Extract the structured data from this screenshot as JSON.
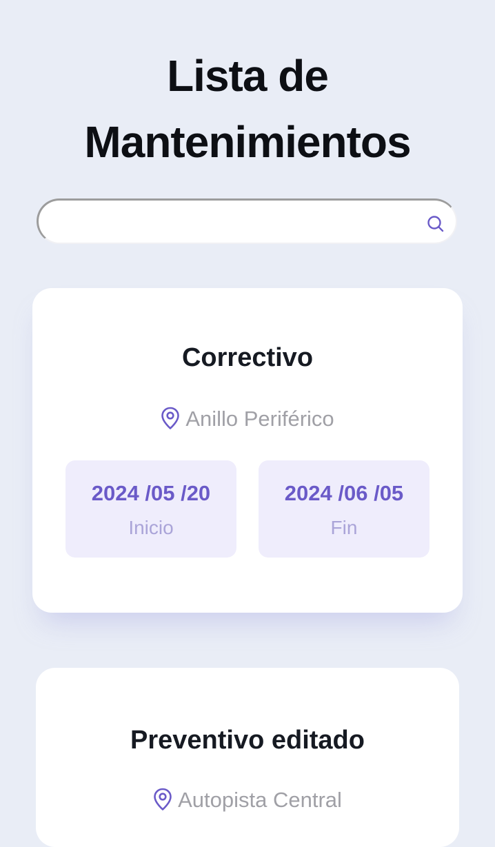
{
  "page": {
    "title_line1": "Lista de",
    "title_line2": "Mantenimientos"
  },
  "search": {
    "value": "",
    "placeholder": "",
    "icon": "search-icon"
  },
  "colors": {
    "background": "#e9edf6",
    "card": "#ffffff",
    "accent": "#6a5ac8",
    "date_box": "#efedfc",
    "muted_text": "#a0a0a6"
  },
  "maintenances": [
    {
      "type": "Correctivo",
      "location_icon": "location-pin-icon",
      "location": "Anillo Periférico",
      "start_date": "2024 /05 /20",
      "start_label": "Inicio",
      "end_date": "2024 /06 /05",
      "end_label": "Fin"
    },
    {
      "type": "Preventivo editado",
      "location_icon": "location-pin-icon",
      "location": "Autopista Central"
    }
  ]
}
